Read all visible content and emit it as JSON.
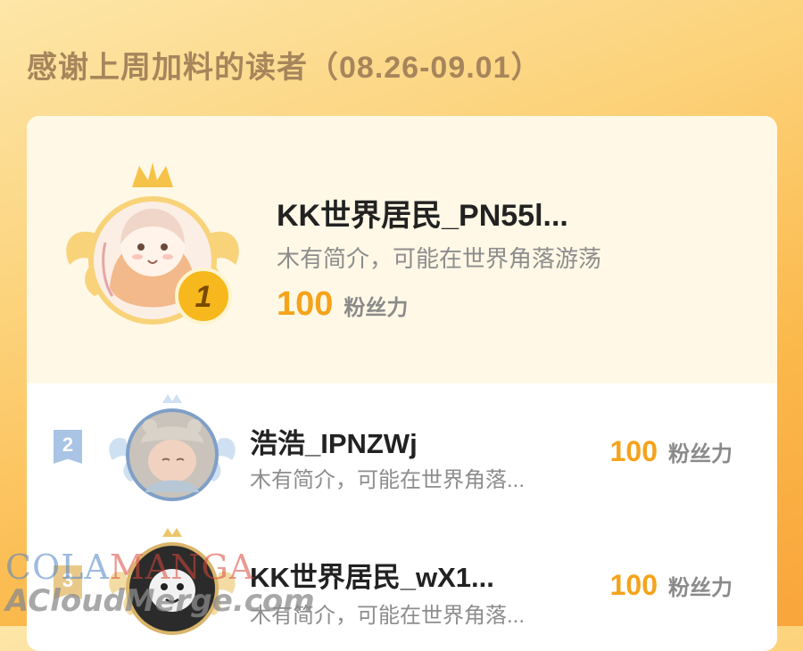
{
  "header": {
    "title": "感谢上周加料的读者（08.26-09.01）"
  },
  "readers": [
    {
      "rank": "1",
      "name": "KK世界居民_PN55l...",
      "bio": "木有简介，可能在世界角落游荡",
      "fans": "100",
      "fans_unit": "粉丝力"
    },
    {
      "rank": "2",
      "name": "浩浩_IPNZWj",
      "bio": "木有简介，可能在世界角落...",
      "fans": "100",
      "fans_unit": "粉丝力"
    },
    {
      "rank": "3",
      "name": "KK世界居民_wX1...",
      "bio": "木有简介，可能在世界角落...",
      "fans": "100",
      "fans_unit": "粉丝力"
    }
  ],
  "watermark": {
    "line1_a": "COLA",
    "line1_b": "MANGA",
    "line2": "ACloudMerge.com"
  },
  "colors": {
    "accent": "#f4a31b",
    "gold": "#f6c34a",
    "silver": "#a9c4e4",
    "bronze": "#e9c98a"
  }
}
